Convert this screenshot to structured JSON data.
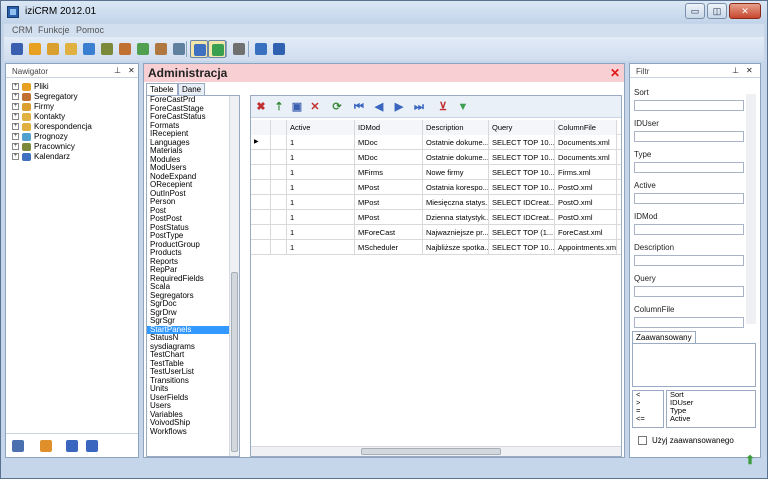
{
  "window": {
    "title": "iziCRM 2012.01",
    "buttons": [
      "▭",
      "◫",
      "✕"
    ]
  },
  "menu": [
    "CRM",
    "Funkcje",
    "Pomoc"
  ],
  "toolbar": {
    "icons": [
      {
        "name": "book-icon",
        "color": "#3a5fb0"
      },
      {
        "name": "box-icon",
        "color": "#e8a020"
      },
      {
        "name": "house-icon",
        "color": "#d9a030"
      },
      {
        "name": "mail-icon",
        "color": "#e0b040"
      },
      {
        "name": "sigma-icon",
        "color": "#3a7fd0"
      },
      {
        "name": "users-icon",
        "color": "#7a8a3a"
      },
      {
        "name": "network-icon",
        "color": "#c07030"
      },
      {
        "name": "database-icon",
        "color": "#50a050"
      },
      {
        "name": "chart-icon",
        "color": "#b07840"
      },
      {
        "name": "report-icon",
        "color": "#6080a0"
      },
      {
        "name": "grid-settings-icon",
        "color": "#4070c0"
      },
      {
        "name": "filter-icon",
        "color": "#3aa050"
      },
      {
        "name": "plugin-icon",
        "color": "#707070"
      },
      {
        "name": "info-icon",
        "color": "#3a70c0"
      },
      {
        "name": "help-icon",
        "color": "#3060b0"
      }
    ]
  },
  "navigator": {
    "title": "Nawigator",
    "items": [
      {
        "label": "Pliki",
        "color": "#e8a020"
      },
      {
        "label": "Segregatory",
        "color": "#c07030"
      },
      {
        "label": "Firmy",
        "color": "#d9a030"
      },
      {
        "label": "Kontakty",
        "color": "#e0b040"
      },
      {
        "label": "Korespondencja",
        "color": "#e0b040"
      },
      {
        "label": "Prognozy",
        "color": "#50a0d0"
      },
      {
        "label": "Pracownicy",
        "color": "#7a8a3a"
      },
      {
        "label": "Kalendarz",
        "color": "#4070c0"
      }
    ]
  },
  "admin": {
    "title": "Administracja",
    "tabs": [
      "Tabele",
      "Dane bazy"
    ],
    "tables": [
      "ForeCastPrd",
      "ForeCastStage",
      "ForeCastStatus",
      "Formats",
      "IRecepient",
      "Languages",
      "Materials",
      "Modules",
      "ModUsers",
      "NodeExpand",
      "ORecepient",
      "OutInPost",
      "Person",
      "Post",
      "PostPost",
      "PostStatus",
      "PostType",
      "ProductGroup",
      "Products",
      "Reports",
      "RepPar",
      "RequiredFields",
      "Scala",
      "Segregators",
      "SgrDoc",
      "SgrDrw",
      "SgrSgr",
      "StartPanels",
      "StatusN",
      "sysdiagrams",
      "TestChart",
      "TestTable",
      "TestUserList",
      "Transitions",
      "Units",
      "UserFields",
      "Users",
      "Variables",
      "VoivodShip",
      "Workflows"
    ],
    "selected_table": "StartPanels",
    "grid": {
      "columns": [
        "Active",
        "IDMod",
        "Description",
        "Query",
        "ColumnFile"
      ],
      "rows": [
        [
          "1",
          "MDoc",
          "Ostatnie dokume...",
          "SELECT TOP 10...",
          "Documents.xml"
        ],
        [
          "1",
          "MDoc",
          "Ostatnie dokume...",
          "SELECT TOP 10...",
          "Documents.xml"
        ],
        [
          "1",
          "MFirms",
          "Nowe firmy",
          "SELECT TOP 10...",
          "Firms.xml"
        ],
        [
          "1",
          "MPost",
          "Ostatnia korespo...",
          "SELECT TOP 10...",
          "PostO.xml"
        ],
        [
          "1",
          "MPost",
          "Miesięczna statys...",
          "SELECT IDCreat...",
          "PostO.xml"
        ],
        [
          "1",
          "MPost",
          "Dzienna statystyk...",
          "SELECT IDCreat...",
          "PostO.xml"
        ],
        [
          "1",
          "MForeCast",
          "Najwazniejsze pr...",
          "SELECT TOP (1...",
          "ForeCast.xml"
        ],
        [
          "1",
          "MScheduler",
          "Najbliższe spotka...",
          "SELECT TOP 10...",
          "Appointments.xml"
        ]
      ]
    }
  },
  "filter": {
    "title": "Filtr",
    "fields": [
      "Sort",
      "IDUser",
      "Type",
      "Active",
      "IDMod",
      "Description",
      "Query",
      "ColumnFile"
    ],
    "advanced_tab": "Zaawansowany",
    "operators": [
      "<",
      ">",
      "=",
      "<="
    ],
    "columns_list": [
      "Sort",
      "IDUser",
      "Type",
      "Active"
    ],
    "use_advanced_label": "Użyj zaawansowanego"
  }
}
